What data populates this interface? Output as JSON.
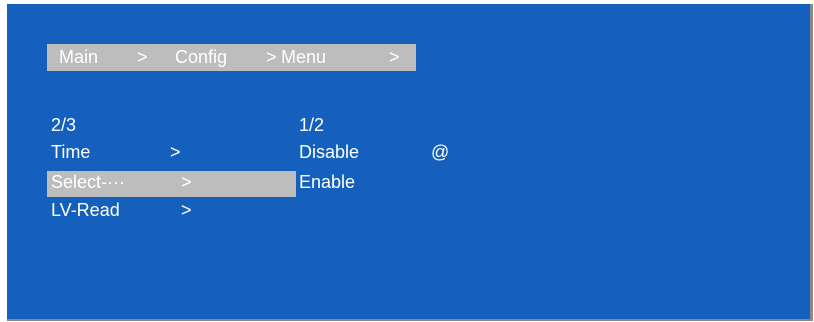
{
  "breadcrumb": {
    "items": [
      "Main",
      "Config",
      "Menu"
    ],
    "separator": ">"
  },
  "left_menu": {
    "page_indicator": "2/3",
    "items": [
      {
        "label": "Time",
        "arrow": ">"
      },
      {
        "label": "Select-···",
        "arrow": ">",
        "selected": true
      },
      {
        "label": "LV-Read",
        "arrow": ">"
      }
    ]
  },
  "right_menu": {
    "page_indicator": "1/2",
    "options": [
      {
        "label": "Disable",
        "marker": "@"
      },
      {
        "label": "Enable",
        "marker": ""
      }
    ]
  },
  "colors": {
    "screen_background": "#1560bd",
    "highlight": "#bdbdbd",
    "text": "#ffffff"
  }
}
